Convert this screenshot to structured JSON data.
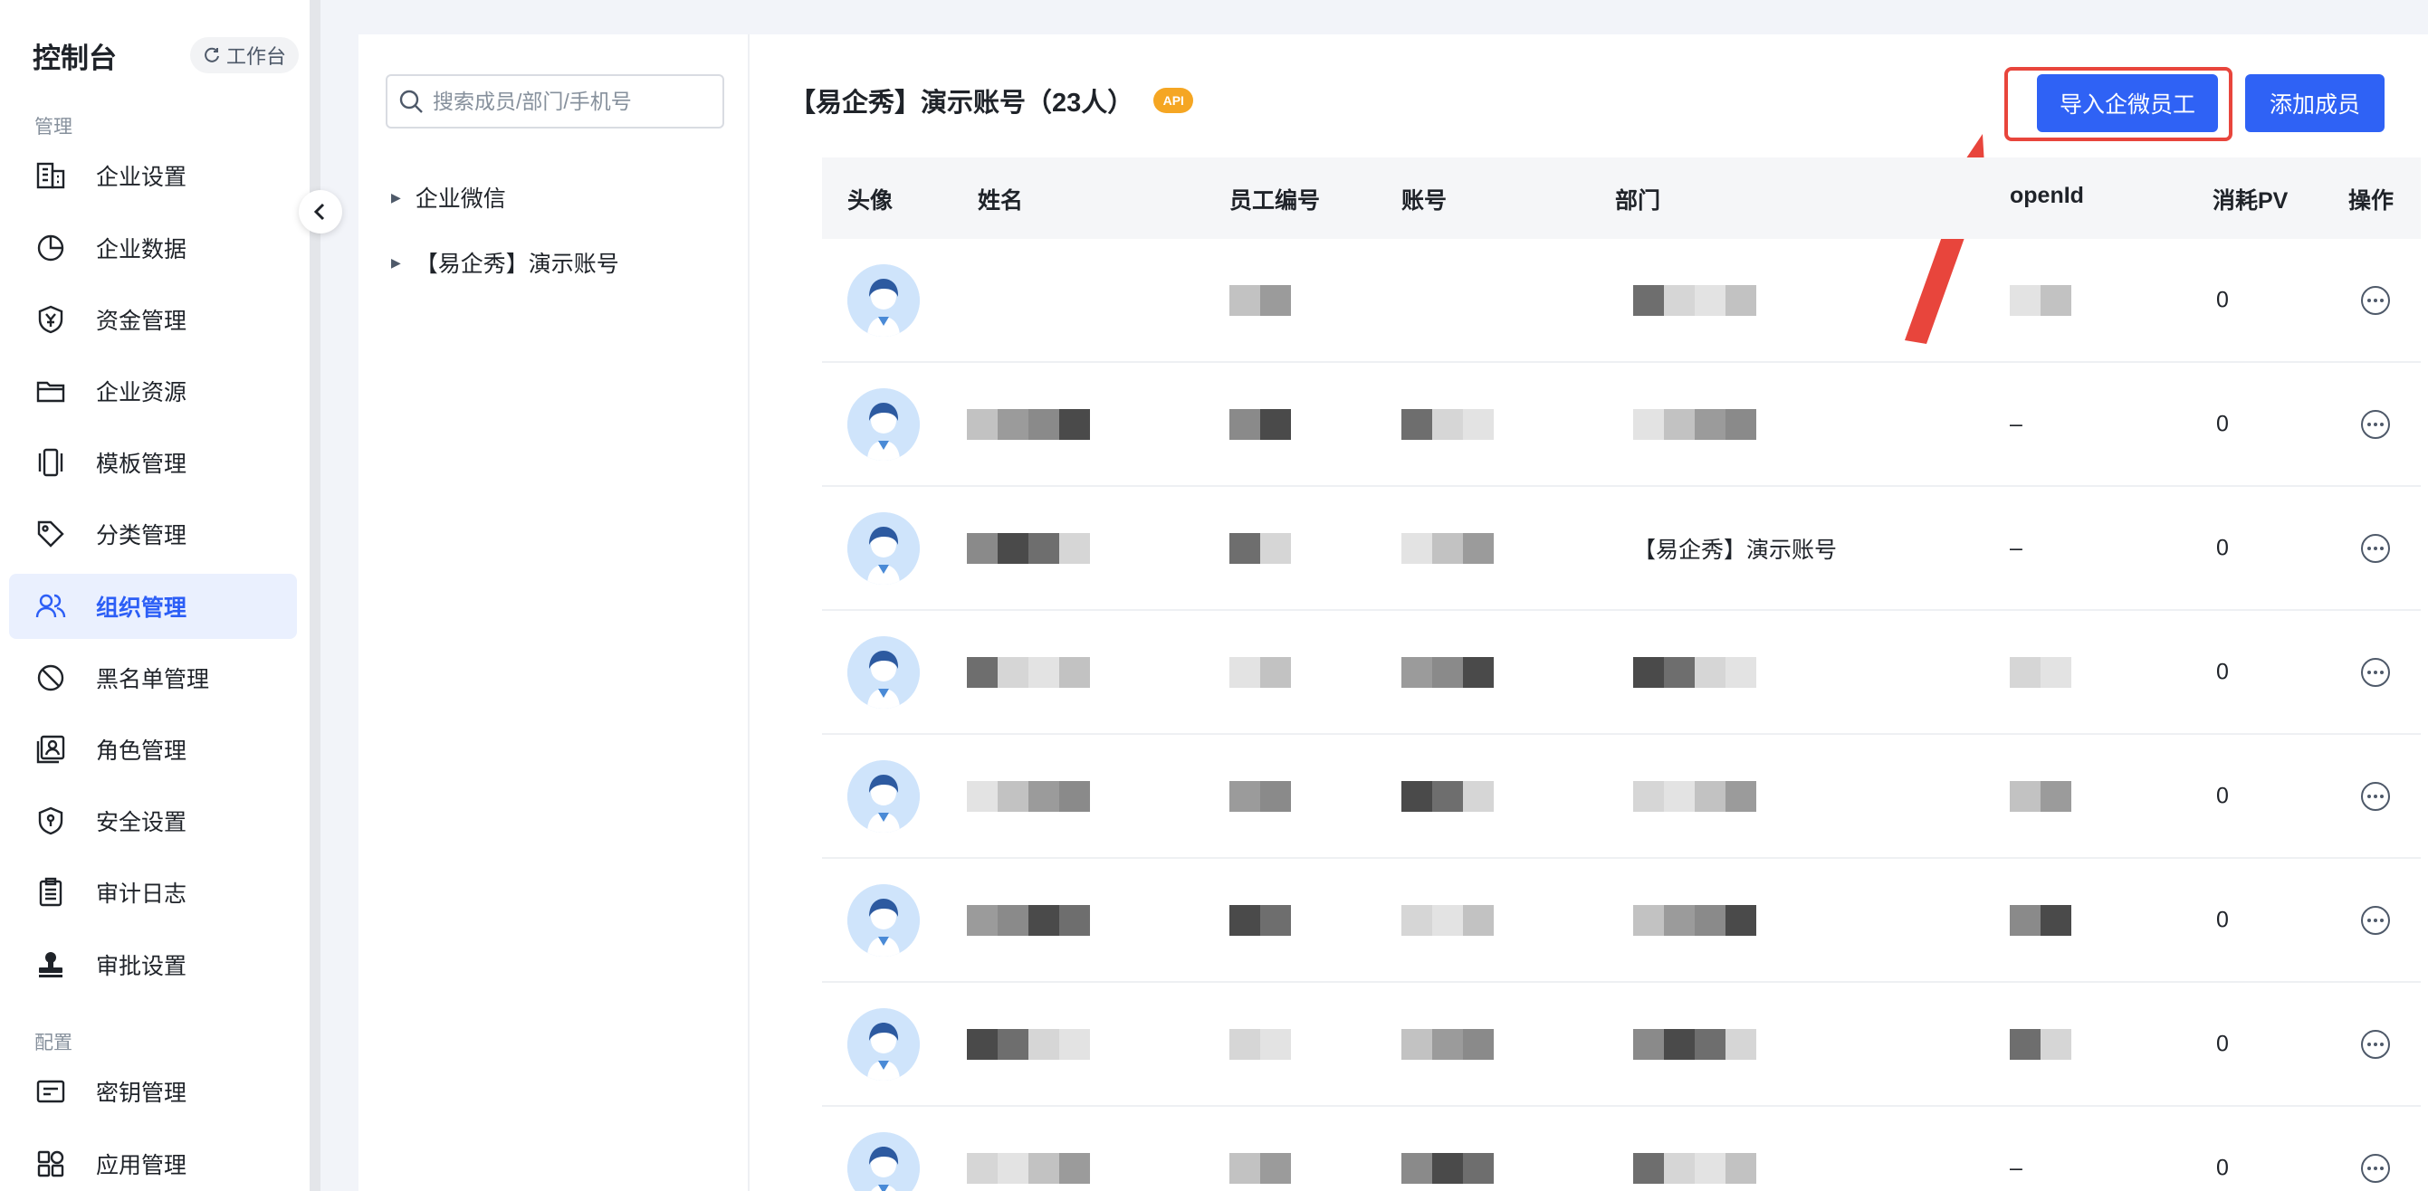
{
  "sidebar": {
    "title": "控制台",
    "workbench_label": "工作台",
    "groups": {
      "manage": "管理",
      "config": "配置"
    },
    "items": [
      {
        "label": "企业设置",
        "icon": "building-icon"
      },
      {
        "label": "企业数据",
        "icon": "pie-chart-icon"
      },
      {
        "label": "资金管理",
        "icon": "yuan-shield-icon"
      },
      {
        "label": "企业资源",
        "icon": "folder-icon"
      },
      {
        "label": "模板管理",
        "icon": "template-icon"
      },
      {
        "label": "分类管理",
        "icon": "tag-icon"
      },
      {
        "label": "组织管理",
        "icon": "users-icon",
        "active": true
      },
      {
        "label": "黑名单管理",
        "icon": "ban-icon"
      },
      {
        "label": "角色管理",
        "icon": "role-icon"
      },
      {
        "label": "安全设置",
        "icon": "security-icon"
      },
      {
        "label": "审计日志",
        "icon": "clipboard-icon"
      },
      {
        "label": "审批设置",
        "icon": "stamp-icon"
      },
      {
        "label": "密钥管理",
        "icon": "key-card-icon"
      },
      {
        "label": "应用管理",
        "icon": "apps-icon"
      }
    ]
  },
  "tree": {
    "search_placeholder": "搜索成员/部门/手机号",
    "nodes": [
      "企业微信",
      "【易企秀】演示账号"
    ]
  },
  "main": {
    "title": "【易企秀】演示账号（23人）",
    "badge": "API",
    "import_button": "导入企微员工",
    "add_button": "添加成员",
    "columns": [
      "头像",
      "姓名",
      "员工编号",
      "账号",
      "部门",
      "openId",
      "消耗PV",
      "操作"
    ],
    "rows": [
      {
        "name": "",
        "emp_no": "",
        "account": "",
        "dept": "",
        "openid": "",
        "pv": "0"
      },
      {
        "name": "",
        "emp_no": "",
        "account": "",
        "dept": "",
        "openid": "–",
        "pv": "0"
      },
      {
        "name": "",
        "emp_no": "",
        "account": "",
        "dept": "【易企秀】演示账号",
        "openid": "–",
        "pv": "0"
      },
      {
        "name": "",
        "emp_no": "",
        "account": "",
        "dept": "",
        "openid": "",
        "pv": "0"
      },
      {
        "name": "",
        "emp_no": "",
        "account": "",
        "dept": "",
        "openid": "",
        "pv": "0"
      },
      {
        "name": "",
        "emp_no": "",
        "account": "",
        "dept": "",
        "openid": "",
        "pv": "0"
      },
      {
        "name": "",
        "emp_no": "",
        "account": "",
        "dept": "",
        "openid": "",
        "pv": "0"
      },
      {
        "name": "",
        "emp_no": "",
        "account": "",
        "dept": "",
        "openid": "–",
        "pv": "0"
      }
    ]
  },
  "colors": {
    "accent": "#2f62f5",
    "highlight": "#e8453c",
    "active_bg": "#eaf0fe"
  }
}
